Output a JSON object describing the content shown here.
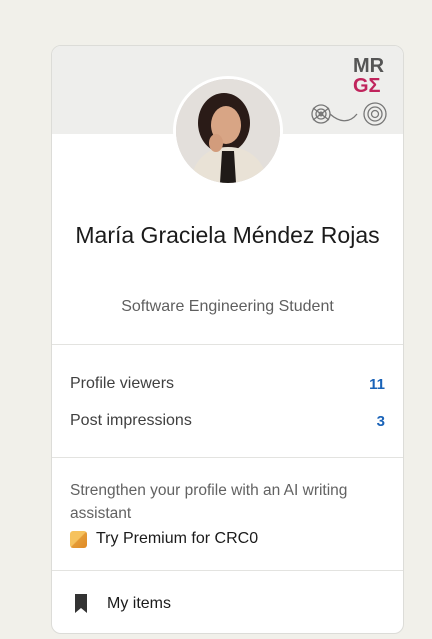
{
  "profile": {
    "name": "María Graciela Méndez Rojas",
    "headline": "Software Engineering Student",
    "banner_logo_text_line1": "MR",
    "banner_logo_text_line2": "GΣ"
  },
  "stats": [
    {
      "label": "Profile viewers",
      "value": "11"
    },
    {
      "label": "Post impressions",
      "value": "3"
    }
  ],
  "promo": {
    "text": "Strengthen your profile with an AI writing assistant",
    "link_label": "Try Premium for CRC0",
    "icon": "premium-icon"
  },
  "my_items": {
    "label": "My items",
    "icon": "bookmark-icon"
  },
  "colors": {
    "background": "#f1f0ea",
    "card": "#ffffff",
    "stat_value": "#1a63b8",
    "premium_gold": "#e49a35"
  }
}
